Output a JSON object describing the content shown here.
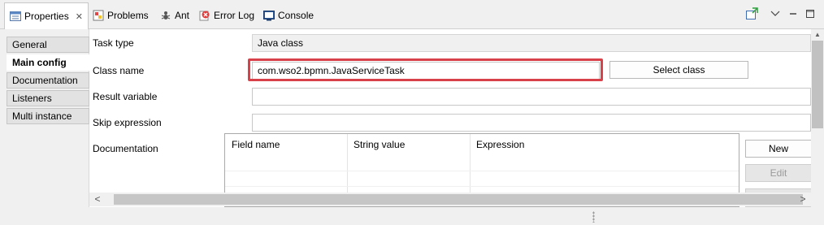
{
  "tabs": [
    {
      "label": "Properties",
      "icon": "properties-icon",
      "active": true,
      "close_icon": "close-icon"
    },
    {
      "label": "Problems",
      "icon": "problems-icon"
    },
    {
      "label": "Ant",
      "icon": "ant-icon"
    },
    {
      "label": "Error Log",
      "icon": "error-log-icon"
    },
    {
      "label": "Console",
      "icon": "console-icon"
    }
  ],
  "view_toolbar": [
    "pin-icon",
    "view-menu-icon",
    "minimize-icon",
    "maximize-icon"
  ],
  "sidebar": {
    "items": [
      {
        "label": "General",
        "active": false
      },
      {
        "label": "Main config",
        "active": true
      },
      {
        "label": "Documentation",
        "active": false
      },
      {
        "label": "Listeners",
        "active": false
      },
      {
        "label": "Multi instance",
        "active": false
      }
    ]
  },
  "form": {
    "task_type": {
      "label": "Task type",
      "value": "Java class"
    },
    "class_name": {
      "label": "Class name",
      "value": "com.wso2.bpmn.JavaServiceTask",
      "button": "Select class"
    },
    "result_variable": {
      "label": "Result variable",
      "value": ""
    },
    "skip_expression": {
      "label": "Skip expression",
      "value": ""
    },
    "documentation": {
      "label": "Documentation"
    }
  },
  "fields_table": {
    "columns": [
      "Field name",
      "String value",
      "Expression"
    ],
    "buttons": {
      "new": "New",
      "edit": "Edit"
    }
  },
  "colors": {
    "highlight": "#d9414a",
    "active_tab_bg": "#ffffff",
    "panel_bg": "#f0f0f0"
  }
}
